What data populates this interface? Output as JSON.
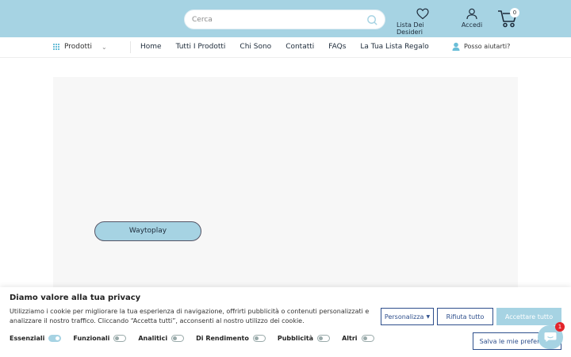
{
  "header": {
    "search_placeholder": "Cerca",
    "wishlist_label": "Lista Dei Desideri",
    "account_label": "Accedi",
    "cart_count": "0",
    "brand_color": "#a6d3e3"
  },
  "nav": {
    "category_label": "Prodotti",
    "links": [
      "Home",
      "Tutti I Prodotti",
      "Chi Sono",
      "Contatti",
      "FAQs",
      "La Tua Lista Regalo"
    ],
    "help_label": "Posso aiutarti?"
  },
  "main": {
    "cta_label": "Waytoplay"
  },
  "cookie": {
    "title": "Diamo valore alla tua privacy",
    "text": "Utilizziamo i cookie per migliorare la tua esperienza di navigazione, offrirti pubblicità o contenuti personalizzati e analizzare il nostro traffico. Cliccando “Accetta tutti”, acconsenti al nostro utilizzo dei cookie.",
    "customize_label": "Personalizza",
    "reject_label": "Rifiuta tutto",
    "accept_label": "Accettare tutto",
    "save_label": "Salva le mie preferenze",
    "toggles": [
      {
        "label": "Essenziali",
        "on": true
      },
      {
        "label": "Funzionali",
        "on": false
      },
      {
        "label": "Analitici",
        "on": false
      },
      {
        "label": "Di Rendimento",
        "on": false
      },
      {
        "label": "Pubblicità",
        "on": false
      },
      {
        "label": "Altri",
        "on": false
      }
    ]
  },
  "chat": {
    "badge_count": "1"
  }
}
